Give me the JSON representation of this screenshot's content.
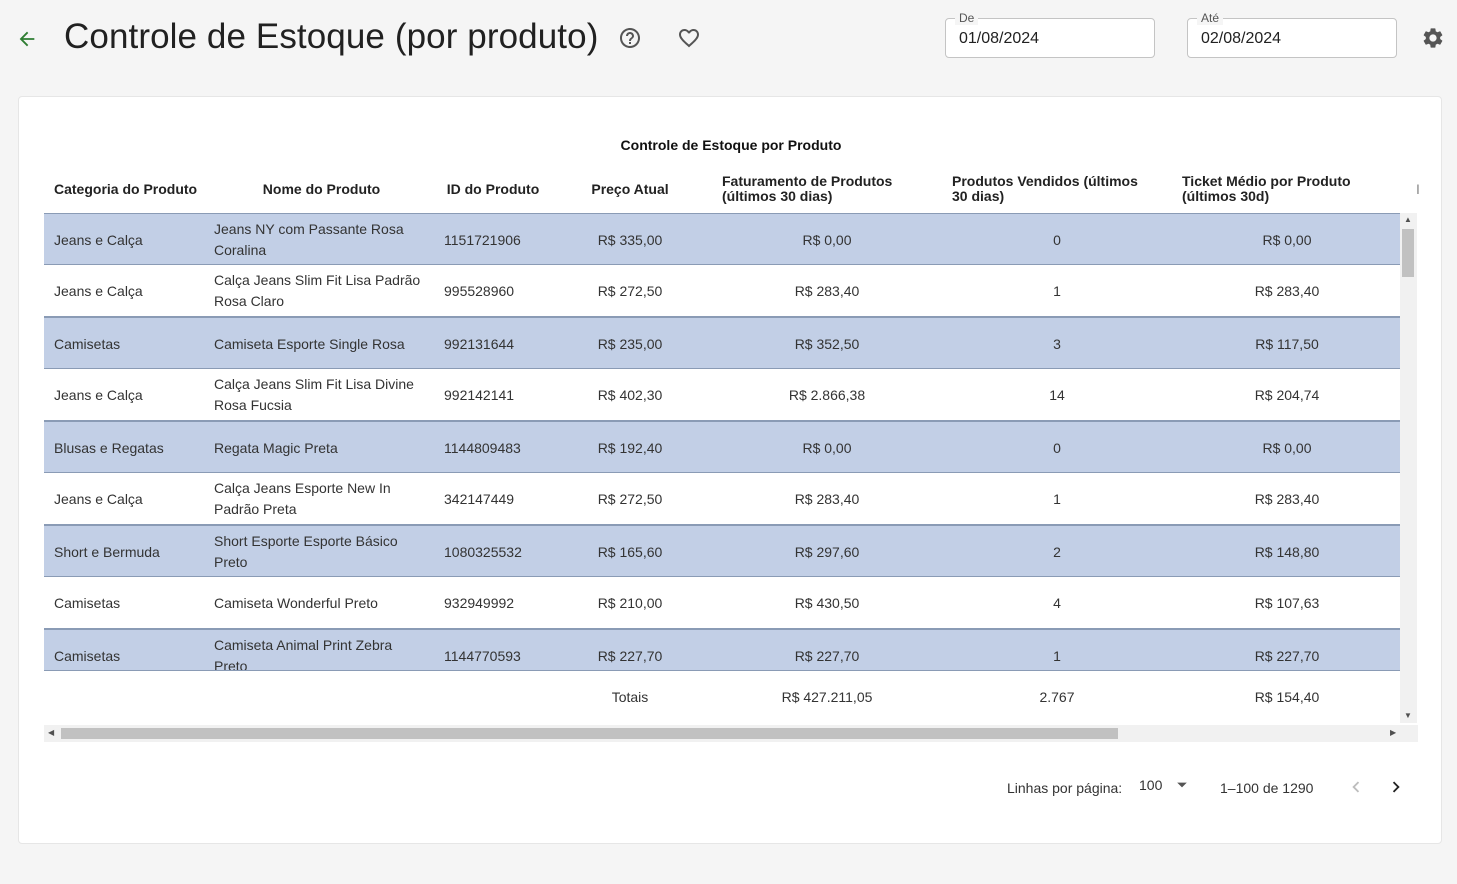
{
  "header": {
    "title": "Controle de Estoque (por produto)",
    "date_from": {
      "label": "De",
      "value": "01/08/2024"
    },
    "date_to": {
      "label": "Até",
      "value": "02/08/2024"
    }
  },
  "table": {
    "title": "Controle de Estoque por Produto",
    "columns": [
      "Categoria do Produto",
      "Nome do Produto",
      "ID do Produto",
      "Preço Atual",
      "Faturamento de Produtos (últimos 30 dias)",
      "Produtos Vendidos (últimos 30 dias)",
      "Ticket Médio por Produto (últimos 30d)",
      "I"
    ],
    "rows": [
      [
        "Jeans e Calça",
        "Jeans NY com Passante Rosa Coralina",
        "1151721906",
        "R$ 335,00",
        "R$ 0,00",
        "0",
        "R$ 0,00"
      ],
      [
        "Jeans e Calça",
        "Calça Jeans Slim Fit Lisa Padrão Rosa Claro",
        "995528960",
        "R$ 272,50",
        "R$ 283,40",
        "1",
        "R$ 283,40"
      ],
      [
        "Camisetas",
        "Camiseta Esporte Single Rosa",
        "992131644",
        "R$ 235,00",
        "R$ 352,50",
        "3",
        "R$ 117,50"
      ],
      [
        "Jeans e Calça",
        "Calça Jeans Slim Fit Lisa Divine Rosa Fucsia",
        "992142141",
        "R$ 402,30",
        "R$ 2.866,38",
        "14",
        "R$ 204,74"
      ],
      [
        "Blusas e Regatas",
        "Regata Magic Preta",
        "1144809483",
        "R$ 192,40",
        "R$ 0,00",
        "0",
        "R$ 0,00"
      ],
      [
        "Jeans e Calça",
        "Calça Jeans Esporte New In Padrão Preta",
        "342147449",
        "R$ 272,50",
        "R$ 283,40",
        "1",
        "R$ 283,40"
      ],
      [
        "Short e Bermuda",
        "Short Esporte Esporte Básico Preto",
        "1080325532",
        "R$ 165,60",
        "R$ 297,60",
        "2",
        "R$ 148,80"
      ],
      [
        "Camisetas",
        "Camiseta Wonderful Preto",
        "932949992",
        "R$ 210,00",
        "R$ 430,50",
        "4",
        "R$ 107,63"
      ],
      [
        "Camisetas",
        "Camiseta Animal Print Zebra Preto",
        "1144770593",
        "R$ 227,70",
        "R$ 227,70",
        "1",
        "R$ 227,70"
      ]
    ],
    "totals": {
      "label": "Totais",
      "revenue": "R$ 427.211,05",
      "sold": "2.767",
      "ticket": "R$ 154,40"
    },
    "colors": {
      "alt_row": "#c2cfe6",
      "row_border": "#8a9bb5"
    }
  },
  "pagination": {
    "rows_per_page_label": "Linhas por página:",
    "rows_per_page_value": "100",
    "range": "1–100 de 1290"
  },
  "icons": {
    "back": "arrow-left-icon",
    "help": "help-circle-icon",
    "favorite": "heart-outline-icon",
    "settings": "gear-icon",
    "dropdown": "caret-down-icon",
    "prev": "chevron-left-icon",
    "next": "chevron-right-icon"
  },
  "accent_color": "#2e7d32"
}
